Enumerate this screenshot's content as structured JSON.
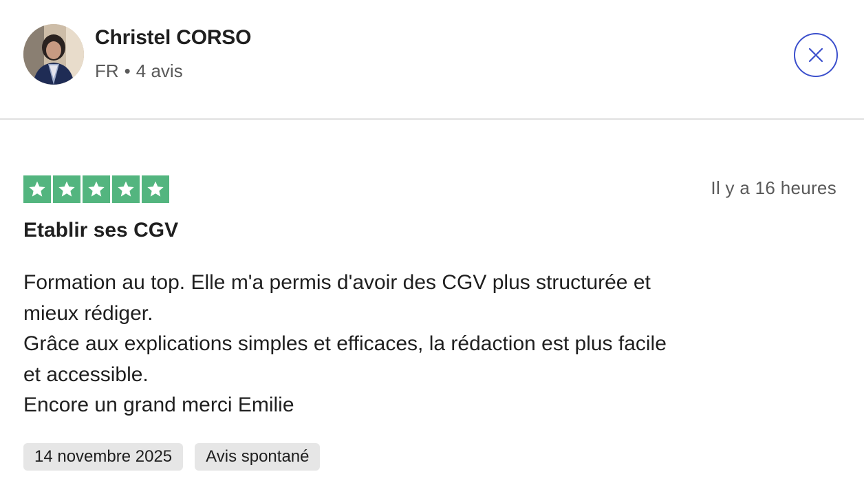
{
  "reviewer": {
    "name": "Christel CORSO",
    "country": "FR",
    "separator": "•",
    "review_count": "4 avis"
  },
  "review": {
    "rating": 5,
    "rating_max": 5,
    "relative_date": "Il y a 16 heures",
    "title": "Etablir ses CGV",
    "body_lines": [
      "Formation au top. Elle m'a permis d'avoir des CGV plus structurée et",
      "mieux rédiger.",
      "Grâce aux explications simples et efficaces, la rédaction est plus facile",
      "et accessible.",
      "Encore un grand merci Emilie"
    ],
    "tags": {
      "date": "14 novembre 2025",
      "type": "Avis spontané"
    }
  },
  "icons": {
    "close": "close-icon",
    "star": "star-icon"
  },
  "colors": {
    "star_green": "#53b57f",
    "close_blue": "#3b4fcc",
    "tag_bg": "#e6e6e6",
    "divider": "#e0e0e0"
  }
}
